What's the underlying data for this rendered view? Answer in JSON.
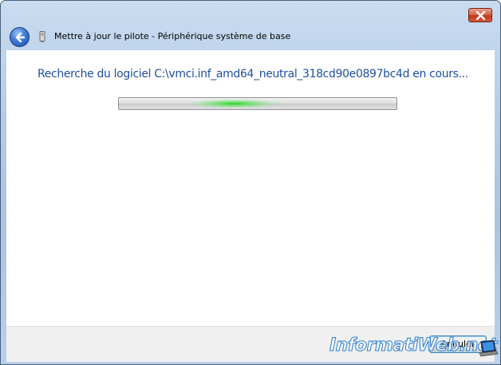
{
  "window": {
    "title": "Mettre à jour le pilote - Périphérique système de base"
  },
  "icons": {
    "back": "back-arrow-icon",
    "close": "close-icon",
    "device": "device-icon"
  },
  "content": {
    "status_text": "Recherche du logiciel C:\\vmci.inf_amd64_neutral_318cd90e0897bc4d en cours..."
  },
  "progress": {
    "mode": "marquee",
    "glow_position_fraction": 0.4,
    "glow_color": "#28d228"
  },
  "footer": {
    "cancel_label": "Annuler"
  },
  "watermark": {
    "text": "InformatiWeb.net"
  },
  "colors": {
    "status_text": "#1e4f9e",
    "close_button": "#c03a1e",
    "back_button": "#3f7bd8"
  }
}
